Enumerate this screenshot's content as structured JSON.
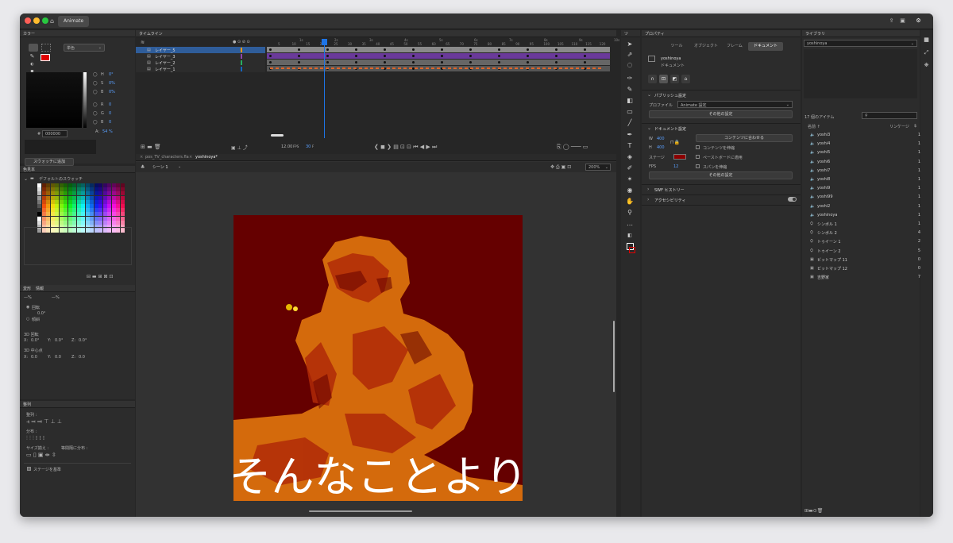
{
  "app": {
    "tab": "Animate"
  },
  "color_panel": {
    "title": "カラー",
    "fill_type": "単色",
    "hsb": [
      {
        "k": "H",
        "v": "0°"
      },
      {
        "k": "S",
        "v": "0%"
      },
      {
        "k": "B",
        "v": "0%"
      }
    ],
    "rgb": [
      {
        "k": "R",
        "v": "0"
      },
      {
        "k": "G",
        "v": "0"
      },
      {
        "k": "B",
        "v": "0"
      }
    ],
    "alpha": {
      "k": "A:",
      "v": "54 %"
    },
    "hex": "000000",
    "add_swatch": "スウォッチに追加",
    "fill_color": "#e00000"
  },
  "swatch_panel": {
    "title": "色見本",
    "folder": "デフォルトのスウォッチ"
  },
  "transform_panel": {
    "tabs": [
      "変形",
      "情報"
    ],
    "w_label": "—%",
    "h_label": "—%",
    "rotate": "回転",
    "rotate_val": "0.0°",
    "skew": "傾斜",
    "rot3d_title": "3D 回転",
    "rot3d": [
      {
        "k": "X:",
        "v": "0.0°"
      },
      {
        "k": "Y:",
        "v": "0.0°"
      },
      {
        "k": "Z:",
        "v": "0.0°"
      }
    ],
    "center3d_title": "3D 中心点",
    "center3d": [
      {
        "k": "X:",
        "v": "0.0"
      },
      {
        "k": "Y:",
        "v": "0.0"
      },
      {
        "k": "Z:",
        "v": "0.0"
      }
    ]
  },
  "align_panel": {
    "title": "整列",
    "align": "整列 :",
    "distribute": "分布 :",
    "match_size": "サイズ揃え :",
    "space": "等間隔に分布 :",
    "stage": "ステージを基準"
  },
  "timeline": {
    "title": "タイムライン",
    "layers": [
      "レイヤー_5",
      "レイヤー_3",
      "レイヤー_2",
      "レイヤー_1"
    ],
    "layer_colors": [
      "#ff9800",
      "#8e44ad",
      "#27ae60",
      "#1565c0"
    ],
    "ruler": [
      "1s",
      "2s",
      "3s",
      "4s",
      "5s",
      "6s",
      "7s",
      "8s",
      "9s",
      "10s"
    ],
    "ruler_frames": [
      "5",
      "10",
      "15",
      "20",
      "25",
      "30",
      "35",
      "40",
      "45",
      "50",
      "55",
      "60",
      "65",
      "70",
      "75",
      "80",
      "85",
      "90",
      "95",
      "100",
      "105",
      "110",
      "115",
      "120"
    ],
    "fps": "12.00",
    "fps_unit": "FPS",
    "frame": "30",
    "frame_unit": "F"
  },
  "document_tabs": [
    "pos_TV_characters.fla",
    "yoshinoya*"
  ],
  "scene": "シーン 1",
  "zoom": "200%",
  "stage": {
    "caption": "そんなことより",
    "bg": "#650000",
    "figure": "#d46a0c"
  },
  "properties": {
    "title": "プロパティ",
    "tabs": [
      "ツール",
      "オブジェクト",
      "フレーム",
      "ドキュメント"
    ],
    "active_tab": "ドキュメント",
    "doc_name": "yoshinoya",
    "doc_type": "ドキュメント",
    "publish_title": "パブリッシュ設定",
    "profile_label": "プロファイル",
    "profile_value": "Animate 設定",
    "more_settings": "その他の設定",
    "doc_settings_title": "ドキュメント設定",
    "w_label": "W",
    "w_value": "400",
    "h_label": "H",
    "h_value": "400",
    "fit_content": "コンテンツに合わせる",
    "scale_content": "コンテンツを伸縮",
    "pasteboard": "ペーストボードに適用",
    "scale_spans": "スパンを伸縮",
    "stage_label": "ステージ",
    "stage_color": "#8b0000",
    "fps_label": "FPS",
    "fps_value": "12",
    "more_settings2": "その他の設定",
    "swf_history": "SWF ヒストリー",
    "accessibility": "アクセシビリティ"
  },
  "library": {
    "title": "ライブラリ",
    "doc": "yoshinoya",
    "count": "17 個のアイテム",
    "col_name": "名前 ↑",
    "col_link": "リンケージ",
    "col_use": "$",
    "items": [
      {
        "icon": "sound",
        "name": "yoshi3",
        "count": "1"
      },
      {
        "icon": "sound",
        "name": "yoshi4",
        "count": "1"
      },
      {
        "icon": "sound",
        "name": "yoshi5",
        "count": "1"
      },
      {
        "icon": "sound",
        "name": "yoshi6",
        "count": "1"
      },
      {
        "icon": "sound",
        "name": "yoshi7",
        "count": "1"
      },
      {
        "icon": "sound",
        "name": "yoshi8",
        "count": "1"
      },
      {
        "icon": "sound",
        "name": "yoshi9",
        "count": "1"
      },
      {
        "icon": "sound",
        "name": "yoshi99",
        "count": "1"
      },
      {
        "icon": "sound",
        "name": "yoshi2",
        "count": "1"
      },
      {
        "icon": "sound",
        "name": "yoshinoya",
        "count": "1"
      },
      {
        "icon": "symbol",
        "name": "シンボル 1",
        "count": "1"
      },
      {
        "icon": "symbol",
        "name": "シンボル 2",
        "count": "4"
      },
      {
        "icon": "symbol",
        "name": "トゥイーン 1",
        "count": "2"
      },
      {
        "icon": "symbol",
        "name": "トゥイーン 2",
        "count": "5"
      },
      {
        "icon": "bitmap",
        "name": "ビットマップ 11",
        "count": "0"
      },
      {
        "icon": "bitmap",
        "name": "ビットマップ 12",
        "count": "0"
      },
      {
        "icon": "bitmap",
        "name": "吉野家",
        "count": "7"
      }
    ]
  }
}
